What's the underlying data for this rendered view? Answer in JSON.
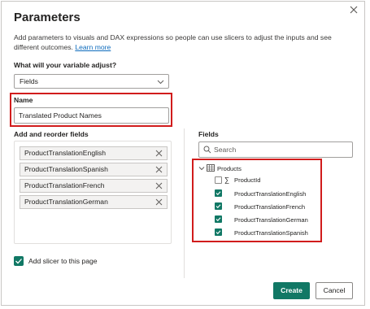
{
  "dialog": {
    "title": "Parameters",
    "description": "Add parameters to visuals and DAX expressions so people can use slicers to adjust the inputs and see different outcomes.",
    "learn_more": "Learn more"
  },
  "variable": {
    "label": "What will your variable adjust?",
    "selected": "Fields"
  },
  "name": {
    "label": "Name",
    "value": "Translated Product Names"
  },
  "add_fields": {
    "label": "Add and reorder fields",
    "items": [
      "ProductTranslationEnglish",
      "ProductTranslationSpanish",
      "ProductTranslationFrench",
      "ProductTranslationGerman"
    ]
  },
  "fields_pane": {
    "label": "Fields",
    "search_placeholder": "Search",
    "table": "Products",
    "columns": [
      {
        "name": "ProductId",
        "checked": false,
        "sigma": true
      },
      {
        "name": "ProductTranslationEnglish",
        "checked": true
      },
      {
        "name": "ProductTranslationFrench",
        "checked": true
      },
      {
        "name": "ProductTranslationGerman",
        "checked": true
      },
      {
        "name": "ProductTranslationSpanish",
        "checked": true
      }
    ]
  },
  "slicer": {
    "label": "Add slicer to this page",
    "checked": true
  },
  "buttons": {
    "create": "Create",
    "cancel": "Cancel"
  },
  "colors": {
    "accent": "#117865",
    "highlight": "#d11c1c",
    "link": "#0f6cbd"
  }
}
